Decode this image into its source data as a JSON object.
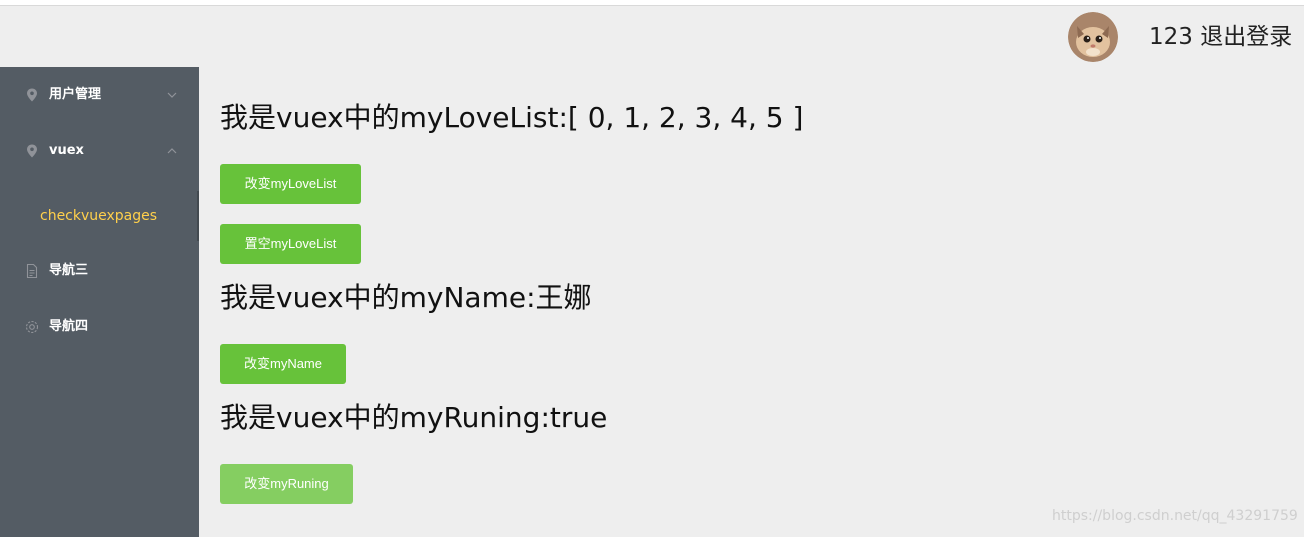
{
  "header": {
    "user_text": "123 退出登录"
  },
  "sidebar": {
    "items": [
      {
        "label": "用户管理",
        "icon": "location-icon",
        "arrow": "chevron-down-icon"
      },
      {
        "label": "vuex",
        "icon": "location-icon",
        "arrow": "chevron-up-icon"
      },
      {
        "label": "导航三",
        "icon": "document-icon"
      },
      {
        "label": "导航四",
        "icon": "gear-icon"
      }
    ],
    "active_sub": "checkvuexpages"
  },
  "main": {
    "love_list_text": "我是vuex中的myLoveList:[ 0, 1, 2, 3, 4, 5 ]",
    "change_love_list_label": "改变myLoveList",
    "clear_love_list_label": "置空myLoveList",
    "name_text": "我是vuex中的myName:王娜",
    "change_name_label": "改变myName",
    "runing_text": "我是vuex中的myRuning:true",
    "change_runing_label": "改变myRuning"
  },
  "watermark": "https://blog.csdn.net/qq_43291759",
  "colors": {
    "sidebar_bg": "#545c64",
    "active_text": "#ffd04b",
    "button": "#67c23a",
    "button_light": "#85ce61"
  }
}
